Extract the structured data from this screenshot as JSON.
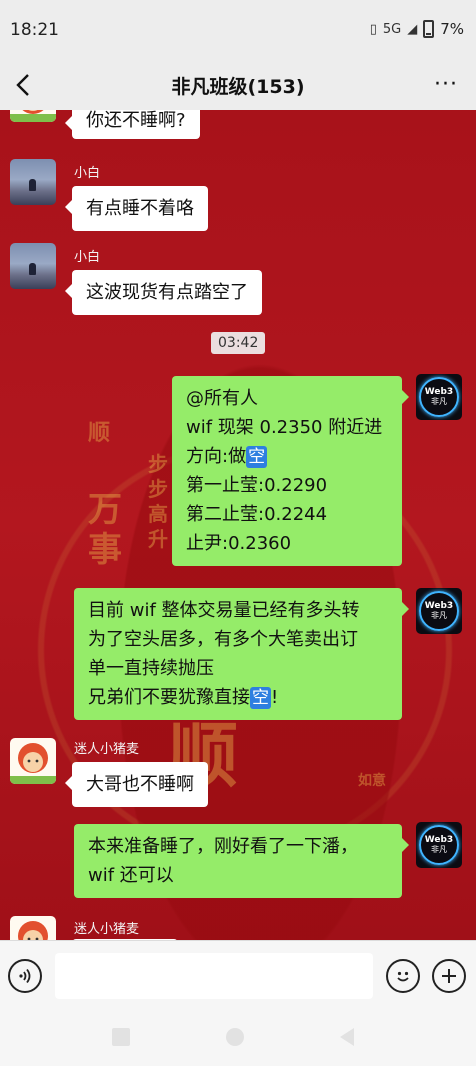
{
  "status_bar": {
    "time": "18:21",
    "network": "5G",
    "battery": "7%"
  },
  "header": {
    "title": "非凡班级(153)",
    "more": "···"
  },
  "watermark": {
    "c1": "步",
    "c2": "步",
    "c3": "高",
    "c4": "升",
    "c5": "万",
    "c6": "事",
    "c7": "顺",
    "c8": "顺",
    "c9": "如意"
  },
  "messages": [
    {
      "sender": "",
      "lines": [
        "你还不睡啊?"
      ]
    },
    {
      "sender": "小白",
      "lines": [
        "有点睡不着咯"
      ]
    },
    {
      "sender": "小白",
      "lines": [
        "这波现货有点踏空了"
      ]
    },
    {
      "time": "03:42"
    },
    {
      "sender": "Web3 非凡",
      "lines": [
        "@所有人",
        "wif 现架 0.2350 附近进",
        "方向:做",
        "第一止莹:0.2290",
        "第二止莹:0.2244",
        "止尹:0.2360"
      ],
      "tag": "空"
    },
    {
      "sender": "Web3 非凡",
      "lines": [
        "目前 wif 整体交易量已经有多头转",
        "为了空头居多，有多个大笔卖出订",
        "单一直持续抛压",
        "兄弟们不要犹豫直接",
        "!"
      ],
      "tag": "空"
    },
    {
      "sender": "迷人小猪麦",
      "lines": [
        "大哥也不睡啊"
      ]
    },
    {
      "sender": "Web3 非凡",
      "lines": [
        "本来准备睡了，刚好看了一下潘，",
        "wif 还可以"
      ]
    },
    {
      "sender": "迷人小猪麦",
      "lines": []
    }
  ],
  "avatars": {
    "web3_line1": "Web3",
    "web3_line2": "非凡"
  },
  "input": {
    "placeholder": "",
    "voice_icon": "voice-icon",
    "emoji_icon": "emoji-icon",
    "plus_icon": "plus-icon"
  },
  "colors": {
    "chat_bg": "#a8121a",
    "green_bubble": "#95ec69",
    "white_bubble": "#ffffff",
    "kong_badge": "#2e7fe0"
  }
}
